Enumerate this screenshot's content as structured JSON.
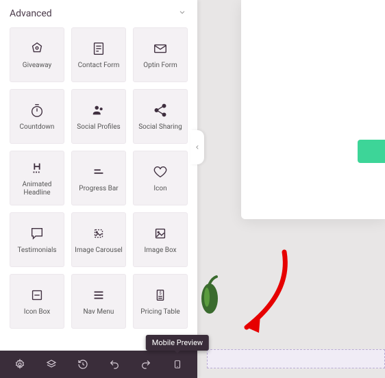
{
  "section": {
    "title": "Advanced"
  },
  "widgets": [
    {
      "label": "Giveaway"
    },
    {
      "label": "Contact Form"
    },
    {
      "label": "Optin Form"
    },
    {
      "label": "Countdown"
    },
    {
      "label": "Social Profiles"
    },
    {
      "label": "Social Sharing"
    },
    {
      "label": "Animated Headline"
    },
    {
      "label": "Progress Bar"
    },
    {
      "label": "Icon"
    },
    {
      "label": "Testimonials"
    },
    {
      "label": "Image Carousel"
    },
    {
      "label": "Image Box"
    },
    {
      "label": "Icon Box"
    },
    {
      "label": "Nav Menu"
    },
    {
      "label": "Pricing Table"
    }
  ],
  "tooltip": {
    "mobile": "Mobile Preview"
  }
}
